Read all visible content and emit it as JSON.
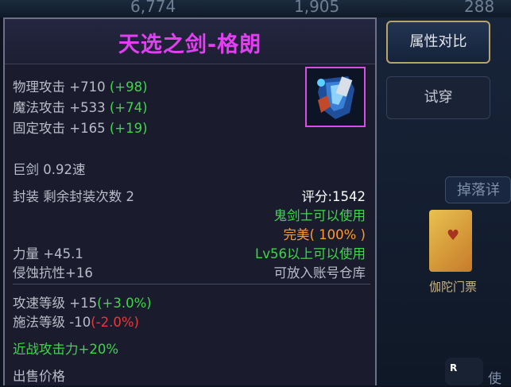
{
  "background": {
    "top_numbers": [
      "6,774",
      "1,905",
      "288"
    ],
    "side_button": "掉落详",
    "card_label": "伽陀门票",
    "small_badge": "R",
    "partial_text": "使"
  },
  "item": {
    "name": "天选之剑-格朗",
    "icon": "greatsword-icon",
    "name_color": "#e23ff2",
    "stats": [
      {
        "label": "物理攻击 +710",
        "bonus": "(+98)"
      },
      {
        "label": "魔法攻击 +533",
        "bonus": "(+74)"
      },
      {
        "label": "固定攻击 +165",
        "bonus": "(+19)"
      }
    ],
    "weapon_type": "巨剑 0.92速",
    "seal": "封装 剩余封装次数 2",
    "score": "评分:1542",
    "usable_by": "鬼剑士可以使用",
    "quality": "完美( 100% )",
    "level_req": "Lv56以上可以使用",
    "strength": "力量 +45.1",
    "corrosion_res": "侵蚀抗性+16",
    "storage": "可放入账号仓库",
    "attack_speed": {
      "label": "攻速等级 +15",
      "value": "(+3.0%)"
    },
    "cast_speed": {
      "label": "施法等级 -10",
      "value": "(-2.0%)"
    },
    "melee": "近战攻击力+20%",
    "sell_price": "出售价格"
  },
  "buttons": {
    "compare": "属性对比",
    "try_on": "试穿"
  }
}
